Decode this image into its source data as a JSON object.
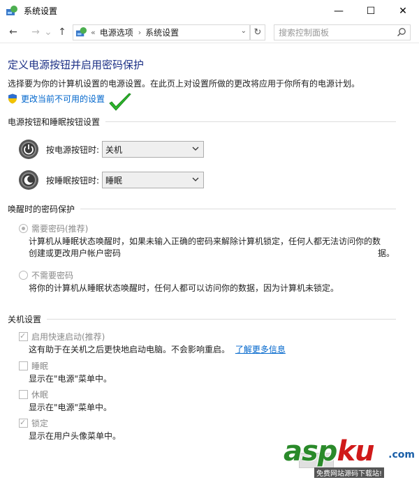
{
  "window": {
    "title": "系统设置",
    "minimize": "—",
    "maximize": "☐",
    "close": "✕"
  },
  "nav": {
    "back": "←",
    "forward": "→",
    "recent": "⌄",
    "up": "↑",
    "breadcrumb_prefix": "«",
    "crumbs": [
      "电源选项",
      "系统设置"
    ],
    "crumb_sep": "›",
    "dropdown": "⌄",
    "refresh": "↻",
    "search_placeholder": "搜索控制面板"
  },
  "header": {
    "title": "定义电源按钮并启用密码保护",
    "description": "选择要为你的计算机设置的电源设置。在此页上对设置所做的更改将应用于你所有的电源计划。",
    "change_link": "更改当前不可用的设置"
  },
  "power_section": {
    "label": "电源按钮和睡眠按钮设置",
    "power_button": {
      "label": "按电源按钮时:",
      "value": "关机"
    },
    "sleep_button": {
      "label": "按睡眠按钮时:",
      "value": "睡眠"
    }
  },
  "password_section": {
    "label": "唤醒时的密码保护",
    "require": {
      "label": "需要密码(推荐)",
      "selected": true,
      "desc": "计算机从睡眠状态唤醒时，如果未输入正确的密码来解除计算机锁定，任何人都无法访问你的数",
      "desc2": "据。",
      "link": "创建或更改用户帐户密码"
    },
    "no_require": {
      "label": "不需要密码",
      "selected": false,
      "desc": "将你的计算机从睡眠状态唤醒时，任何人都可以访问你的数据，因为计算机未锁定。"
    }
  },
  "shutdown_section": {
    "label": "关机设置",
    "items": [
      {
        "label": "启用快速启动(推荐)",
        "checked": true,
        "desc": "这有助于在关机之后更快地启动电脑。不会影响重启。",
        "link": "了解更多信息"
      },
      {
        "label": "睡眠",
        "checked": false,
        "desc": "显示在\"电源\"菜单中。"
      },
      {
        "label": "休眠",
        "checked": false,
        "desc": "显示在\"电源\"菜单中。"
      },
      {
        "label": "锁定",
        "checked": true,
        "desc": "显示在用户头像菜单中。"
      }
    ]
  },
  "watermark": {
    "main_a": "asp",
    "main_b": "ku",
    "suffix": ".com",
    "sub": "免费网站源码下载站!"
  },
  "colors": {
    "title_blue": "#1e3287",
    "link_blue": "#0066cc",
    "accent_green": "#2db82d"
  }
}
